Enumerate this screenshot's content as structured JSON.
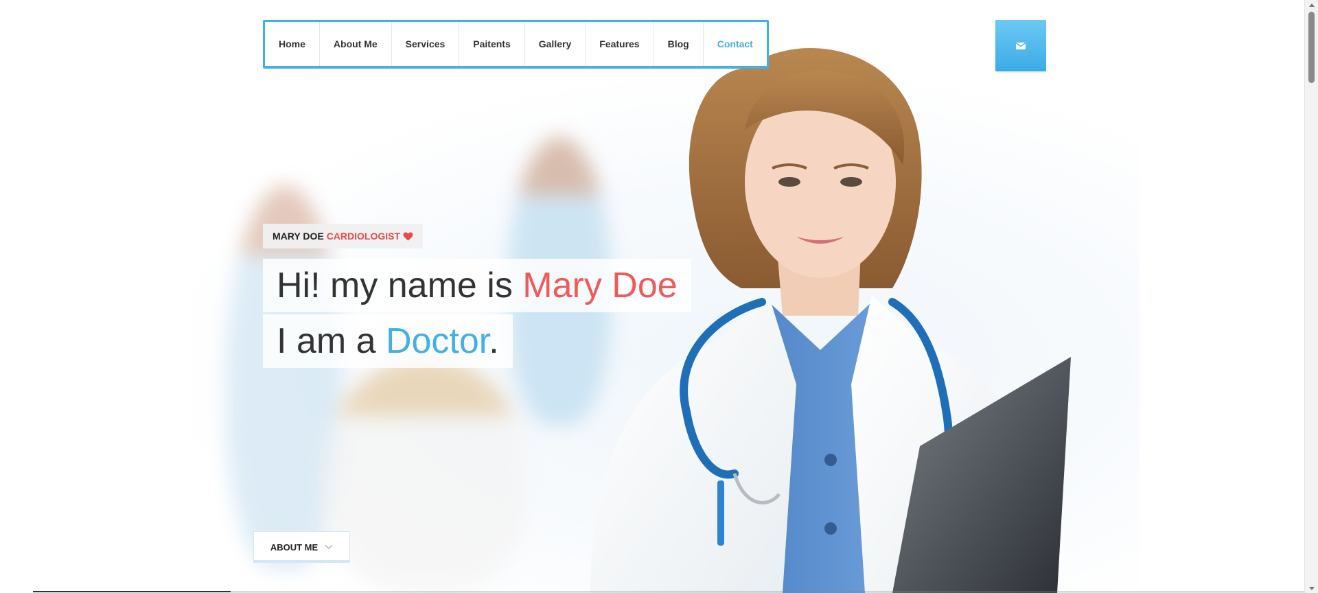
{
  "nav": {
    "items": [
      {
        "label": "Home",
        "active": false
      },
      {
        "label": "About Me",
        "active": false
      },
      {
        "label": "Services",
        "active": false
      },
      {
        "label": "Paitents",
        "active": false
      },
      {
        "label": "Gallery",
        "active": false
      },
      {
        "label": "Features",
        "active": false
      },
      {
        "label": "Blog",
        "active": false
      },
      {
        "label": "Contact",
        "active": true
      }
    ],
    "mail_icon": "envelope-icon"
  },
  "intro": {
    "name": "MARY DOE",
    "title": "CARDIOLOGIST",
    "heart_icon": "heart-icon",
    "line1_prefix": "Hi! my name is ",
    "line1_name": "Mary Doe",
    "line2_prefix": "I am a ",
    "line2_role": "Doctor",
    "line2_suffix": "."
  },
  "about_button": {
    "label": "ABOUT ME",
    "icon": "chevron-down-icon"
  },
  "colors": {
    "accent_blue": "#3fb0e8",
    "accent_red": "#f05a5b",
    "text_dark": "#333333"
  }
}
